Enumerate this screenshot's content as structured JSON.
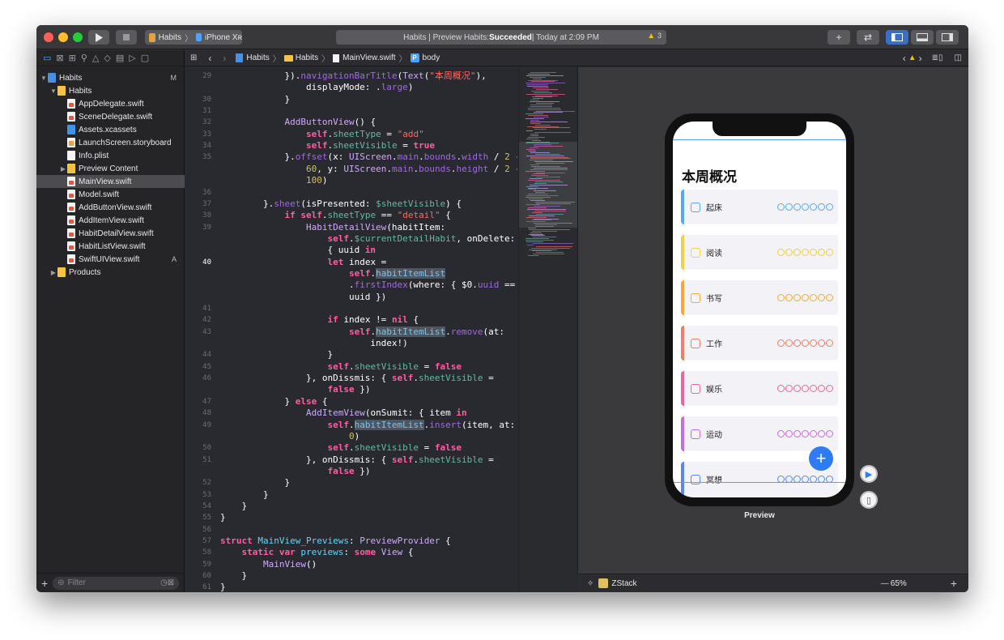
{
  "titlebar": {
    "scheme_project": "Habits",
    "scheme_device": "iPhone Xʀ",
    "status_prefix": "Habits | Preview Habits: ",
    "status_result": "Succeeded",
    "status_suffix": " | Today at 2:09 PM",
    "warning_count": "3"
  },
  "navigator": {
    "icons": [
      "folder-icon",
      "source-control-icon",
      "symbol-icon",
      "find-icon",
      "issue-icon",
      "test-icon",
      "debug-icon",
      "breakpoint-icon",
      "report-icon"
    ],
    "tree": [
      {
        "label": "Habits",
        "badge": "M",
        "indent": 0,
        "kind": "project",
        "disclosure": "▼"
      },
      {
        "label": "Habits",
        "badge": "",
        "indent": 1,
        "kind": "folder",
        "disclosure": "▼"
      },
      {
        "label": "AppDelegate.swift",
        "badge": "",
        "indent": 2,
        "kind": "swift",
        "disclosure": ""
      },
      {
        "label": "SceneDelegate.swift",
        "badge": "",
        "indent": 2,
        "kind": "swift",
        "disclosure": ""
      },
      {
        "label": "Assets.xcassets",
        "badge": "",
        "indent": 2,
        "kind": "assets",
        "disclosure": ""
      },
      {
        "label": "LaunchScreen.storyboard",
        "badge": "",
        "indent": 2,
        "kind": "storyboard",
        "disclosure": ""
      },
      {
        "label": "Info.plist",
        "badge": "",
        "indent": 2,
        "kind": "plist",
        "disclosure": ""
      },
      {
        "label": "Preview Content",
        "badge": "",
        "indent": 2,
        "kind": "folder",
        "disclosure": "▶"
      },
      {
        "label": "MainView.swift",
        "badge": "",
        "indent": 2,
        "kind": "swift",
        "disclosure": "",
        "selected": true
      },
      {
        "label": "Model.swift",
        "badge": "",
        "indent": 2,
        "kind": "swift",
        "disclosure": ""
      },
      {
        "label": "AddButtonView.swift",
        "badge": "",
        "indent": 2,
        "kind": "swift",
        "disclosure": ""
      },
      {
        "label": "AddItemView.swift",
        "badge": "",
        "indent": 2,
        "kind": "swift",
        "disclosure": ""
      },
      {
        "label": "HabitDetailView.swift",
        "badge": "",
        "indent": 2,
        "kind": "swift",
        "disclosure": ""
      },
      {
        "label": "HabitListView.swift",
        "badge": "",
        "indent": 2,
        "kind": "swift",
        "disclosure": ""
      },
      {
        "label": "SwiftUIView.swift",
        "badge": "A",
        "indent": 2,
        "kind": "swift",
        "disclosure": ""
      },
      {
        "label": "Products",
        "badge": "",
        "indent": 1,
        "kind": "folder",
        "disclosure": "▶"
      }
    ],
    "filter_placeholder": "Filter"
  },
  "jumpbar": {
    "crumbs": [
      "Habits",
      "Habits",
      "MainView.swift",
      "body"
    ],
    "warning_icon": "warning-icon"
  },
  "editor": {
    "lines": [
      {
        "n": "29",
        "code": "            }).<m>navigationBarTitle</m>(<t>Text</t>(<s>\"本周概况\"</s>),"
      },
      {
        "n": "",
        "code": "                displayMode: .<m>large</m>)"
      },
      {
        "n": "30",
        "code": "            }"
      },
      {
        "n": "31",
        "code": ""
      },
      {
        "n": "32",
        "code": "            <t>AddButtonView</t>() {"
      },
      {
        "n": "33",
        "code": "                <k>self</k>.<p>sheetType</p> = <s>\"add\"</s>"
      },
      {
        "n": "34",
        "code": "                <k>self</k>.<p>sheetVisible</p> = <k>true</k>"
      },
      {
        "n": "35",
        "code": "            }.<m>offset</m>(x: <t>UIScreen</t>.<m>main</m>.<m>bounds</m>.<m>width</m> / <n>2</n> -"
      },
      {
        "n": "",
        "code": "                <n>60</n>, y: <t>UIScreen</t>.<m>main</m>.<m>bounds</m>.<m>height</m> / <n>2</n> -"
      },
      {
        "n": "",
        "code": "                <n>100</n>)"
      },
      {
        "n": "36",
        "code": ""
      },
      {
        "n": "37",
        "code": "        }.<m>sheet</m>(isPresented: <p>$sheetVisible</p>) {"
      },
      {
        "n": "38",
        "code": "            <k>if</k> <k>self</k>.<p>sheetType</p> == <s>\"detail\"</s> {"
      },
      {
        "n": "39",
        "code": "                <t>HabitDetailView</t>(habitItem:"
      },
      {
        "n": "",
        "code": "                    <k>self</k>.<p>$currentDetailHabit</p>, onDelete:"
      },
      {
        "n": "",
        "code": "                    { uuid <k>in</k>"
      },
      {
        "n": "40",
        "code": "                    <k>let</k> index =",
        "current": true
      },
      {
        "n": "",
        "code": "                        <k>self</k>.<hl>habitItemList</hl>"
      },
      {
        "n": "",
        "code": "                        .<m>firstIndex</m>(where: { $0.<m>uuid</m> =="
      },
      {
        "n": "",
        "code": "                        uuid })"
      },
      {
        "n": "41",
        "code": ""
      },
      {
        "n": "42",
        "code": "                    <k>if</k> index != <k>nil</k> {"
      },
      {
        "n": "43",
        "code": "                        <k>self</k>.<hl>habitItemList</hl>.<m>remove</m>(at:"
      },
      {
        "n": "",
        "code": "                            index!)"
      },
      {
        "n": "44",
        "code": "                    }"
      },
      {
        "n": "45",
        "code": "                    <k>self</k>.<p>sheetVisible</p> = <k>false</k>"
      },
      {
        "n": "46",
        "code": "                }, onDissmis: { <k>self</k>.<p>sheetVisible</p> ="
      },
      {
        "n": "",
        "code": "                    <k>false</k> })"
      },
      {
        "n": "47",
        "code": "            } <k>else</k> {"
      },
      {
        "n": "48",
        "code": "                <t>AddItemView</t>(onSumit: { item <k>in</k>"
      },
      {
        "n": "49",
        "code": "                    <k>self</k>.<hl>habitItemList</hl>.<m>insert</m>(item, at:"
      },
      {
        "n": "",
        "code": "                        <n>0</n>)"
      },
      {
        "n": "50",
        "code": "                    <k>self</k>.<p>sheetVisible</p> = <k>false</k>"
      },
      {
        "n": "51",
        "code": "                }, onDissmis: { <k>self</k>.<p>sheetVisible</p> ="
      },
      {
        "n": "",
        "code": "                    <k>false</k> })"
      },
      {
        "n": "52",
        "code": "            }"
      },
      {
        "n": "53",
        "code": "        }"
      },
      {
        "n": "54",
        "code": "    }"
      },
      {
        "n": "55",
        "code": "}"
      },
      {
        "n": "56",
        "code": ""
      },
      {
        "n": "57",
        "code": "<k>struct</k> <tp>MainView_Previews</tp>: <t>PreviewProvider</t> {"
      },
      {
        "n": "58",
        "code": "    <k>static</k> <k>var</k> <tp>previews</tp>: <k>some</k> <t>View</t> {"
      },
      {
        "n": "59",
        "code": "        <t>MainView</t>()"
      },
      {
        "n": "60",
        "code": "    }"
      },
      {
        "n": "61",
        "code": "}"
      }
    ]
  },
  "preview": {
    "nav_title": "本周概况",
    "label": "Preview",
    "habits": [
      {
        "name": "起床",
        "color": "#5ba7ec",
        "icon": "alarm-clock-icon"
      },
      {
        "name": "阅读",
        "color": "#f1cf4a",
        "icon": "book-icon"
      },
      {
        "name": "书写",
        "color": "#f0a93c",
        "icon": "pencil-icon"
      },
      {
        "name": "工作",
        "color": "#ec7f69",
        "icon": "monitor-icon"
      },
      {
        "name": "娱乐",
        "color": "#e66a98",
        "icon": "gamepad-icon"
      },
      {
        "name": "运动",
        "color": "#c46de0",
        "icon": "dumbbell-icon"
      },
      {
        "name": "冥想",
        "color": "#5b87e8",
        "icon": "lightbulb-icon"
      }
    ],
    "fab_label": "+"
  },
  "canvas_bar": {
    "component": "ZStack",
    "zoom": "65%"
  }
}
